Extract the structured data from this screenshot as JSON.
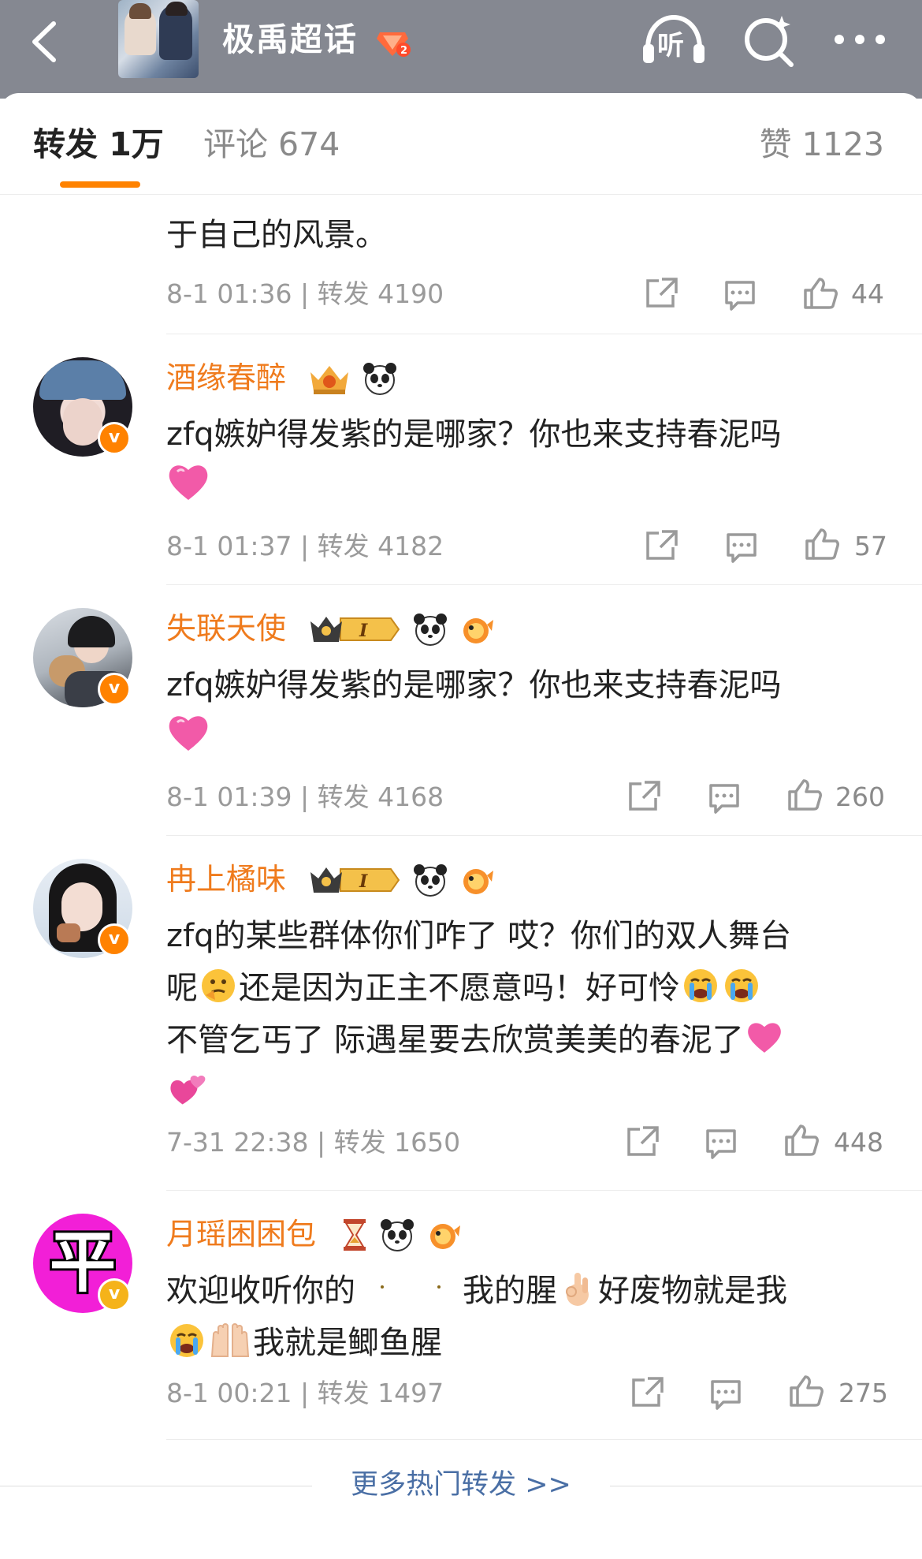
{
  "header": {
    "title": "极禹超话",
    "back_icon": "chevron-left-icon",
    "listen_label": "听",
    "search_icon": "search-sparkle-icon",
    "more_icon": "more-dots-icon"
  },
  "tabs": {
    "repost": "转发 1万",
    "comment": "评论 674",
    "like": "赞 1123"
  },
  "items": [
    {
      "partial_text": "于自己的风景。",
      "time": "8-1 01:36",
      "reposts": "转发 4190",
      "likes": "44"
    },
    {
      "user": "酒缘春醉",
      "text": "zfq嫉妒得发紫的是哪家？你也来支持春泥吗",
      "time": "8-1 01:37",
      "reposts": "转发 4182",
      "likes": "57"
    },
    {
      "user": "失联天使",
      "level": "I",
      "text": "zfq嫉妒得发紫的是哪家？你也来支持春泥吗",
      "time": "8-1 01:39",
      "reposts": "转发 4168",
      "likes": "260"
    },
    {
      "user": "冉上橘味",
      "level": "I",
      "line1": "zfq的某些群体你们咋了 哎？你们的双人舞台",
      "line2a": "呢",
      "line2b": "还是因为正主不愿意吗！好可怜",
      "line3": "不管乞丐了 际遇星要去欣赏美美的春泥了",
      "time": "7-31 22:38",
      "reposts": "转发 1650",
      "likes": "448"
    },
    {
      "user": "月瑶困困包",
      "avatar_char": "平",
      "line1a": "欢迎收听你的",
      "line1b": "我的腥",
      "line1c": "好废物就是我",
      "line2": "我就是鲫鱼腥",
      "time": "8-1 00:21",
      "reposts": "转发 1497",
      "likes": "275"
    }
  ],
  "more_hot": "更多热门转发 >>",
  "colors": {
    "accent": "#ff8200",
    "username": "#ef7b1d",
    "link": "#4a6fa5",
    "header_bg": "#858891"
  }
}
